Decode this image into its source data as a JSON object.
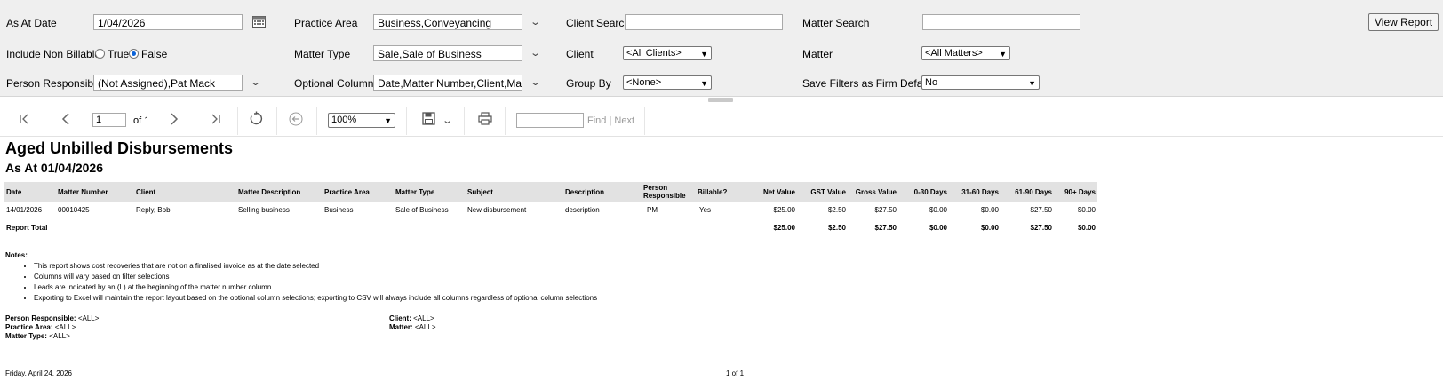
{
  "filters": {
    "as_at_date": {
      "label": "As At Date",
      "value": "1/04/2026"
    },
    "include_non_billable": {
      "label": "Include Non Billable",
      "options": [
        "True",
        "False"
      ],
      "selected": "False"
    },
    "person_responsible": {
      "label": "Person Responsible",
      "value": "(Not Assigned),Pat Mack"
    },
    "practice_area": {
      "label": "Practice Area",
      "value": "Business,Conveyancing"
    },
    "matter_type": {
      "label": "Matter Type",
      "value": "Sale,Sale of Business"
    },
    "optional_columns": {
      "label": "Optional Columns",
      "value": "Date,Matter Number,Client,Matter"
    },
    "client_search": {
      "label": "Client Search",
      "value": ""
    },
    "client": {
      "label": "Client",
      "value": "<All Clients>"
    },
    "group_by": {
      "label": "Group By",
      "value": "<None>"
    },
    "matter_search": {
      "label": "Matter Search",
      "value": ""
    },
    "matter": {
      "label": "Matter",
      "value": "<All Matters>"
    },
    "save_filters": {
      "label": "Save Filters as Firm Default?",
      "value": "No"
    },
    "view_report_label": "View Report"
  },
  "toolbar": {
    "page_value": "1",
    "page_of": "of 1",
    "zoom": "100%",
    "find_label": "Find",
    "find_sep": "|",
    "next_label": "Next",
    "icons": [
      "first-page-icon",
      "previous-page-icon",
      "next-page-icon",
      "last-page-icon",
      "refresh-icon",
      "back-icon",
      "save-icon",
      "print-icon"
    ]
  },
  "report": {
    "title": "Aged Unbilled Disbursements",
    "subtitle": "As At 01/04/2026",
    "columns": [
      "Date",
      "Matter Number",
      "Client",
      "Matter Description",
      "Practice Area",
      "Matter Type",
      "Subject",
      "Description",
      "Person Responsible",
      "Billable?",
      "Net Value",
      "GST Value",
      "Gross Value",
      "0-30 Days",
      "31-60 Days",
      "61-90 Days",
      "90+ Days"
    ],
    "rows": [
      [
        "14/01/2026",
        "00010425",
        "Reply, Bob",
        "Selling business",
        "Business",
        "Sale of Business",
        "New disbursement",
        "description",
        "PM",
        "Yes",
        "$25.00",
        "$2.50",
        "$27.50",
        "$0.00",
        "$0.00",
        "$27.50",
        "$0.00"
      ]
    ],
    "total": {
      "label": "Report Total",
      "values": [
        "$25.00",
        "$2.50",
        "$27.50",
        "$0.00",
        "$0.00",
        "$27.50",
        "$0.00"
      ]
    },
    "notes_label": "Notes:",
    "notes": [
      "This report shows cost recoveries that are not on a finalised invoice as at the date selected",
      "Columns will vary based on filter selections",
      "Leads are indicated by an (L) at the beginning of the matter number column",
      "Exporting to Excel will maintain the report layout based on the optional column selections; exporting to CSV will always include all columns regardless of optional column selections"
    ],
    "filter_summary": {
      "person_responsible": {
        "label": "Person Responsible:",
        "value": "<ALL>"
      },
      "practice_area": {
        "label": "Practice Area:",
        "value": "<ALL>"
      },
      "matter_type": {
        "label": "Matter Type:",
        "value": "<ALL>"
      },
      "client": {
        "label": "Client:",
        "value": "<ALL>"
      },
      "matter": {
        "label": "Matter:",
        "value": "<ALL>"
      }
    },
    "footer_date": "Friday, April 24, 2026",
    "footer_page": "1 of 1"
  }
}
